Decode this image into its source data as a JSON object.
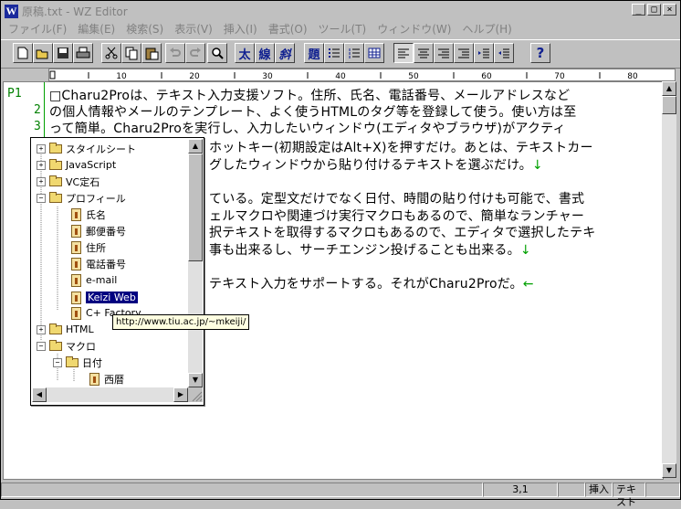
{
  "window": {
    "title": "原稿.txt - WZ Editor",
    "app_icon": "W"
  },
  "menu": [
    "ファイル(F)",
    "編集(E)",
    "検索(S)",
    "表示(V)",
    "挿入(I)",
    "書式(O)",
    "ツール(T)",
    "ウィンドウ(W)",
    "ヘルプ(H)"
  ],
  "toolbar": {
    "buttons": [
      "new-icon",
      "open-icon",
      "save-icon",
      "print-icon",
      "cut-icon",
      "copy-icon",
      "paste-icon",
      "undo-icon",
      "redo-icon",
      "find-icon"
    ],
    "bold": "太",
    "underline": "線",
    "italic": "斜",
    "heading": "題",
    "help": "?"
  },
  "ruler": {
    "labels": [
      "10",
      "20",
      "30",
      "40",
      "50",
      "60",
      "70",
      "80"
    ]
  },
  "editor": {
    "line_numbers": [
      "P1",
      "2",
      "3"
    ],
    "lines": [
      "□Charu2Proは、テキスト入力支援ソフト。住所、氏名、電話番号、メールアドレスなど",
      "の個人情報やメールのテンプレート、よく使うHTMLのタグ等を登録して使う。使い方は至",
      "って簡単。Charu2Proを実行し、入力したいウィンドウ(エディタやブラウザ)がアクティ",
      "ホットキー(初期設定はAlt+X)を押すだけ。あとは、テキストカー",
      "グしたウィンドウから貼り付けるテキストを選ぶだけ。",
      "",
      "ている。定型文だけでなく日付、時間の貼り付けも可能で、書式",
      "ェルマクロや関連づけ実行マクロもあるので、簡単なランチャー",
      "択テキストを取得するマクロもあるので、エディタで選択したテキ",
      "事も出来るし、サーチエンジン投げることも出来る。",
      "",
      "テキスト入力をサポートする。それがCharu2Proだ。"
    ],
    "eol_arrow": "↓",
    "eof_mark": "←"
  },
  "tree": {
    "items": [
      {
        "label": "スタイルシート",
        "type": "folder",
        "expander": "+"
      },
      {
        "label": "JavaScript",
        "type": "folder",
        "expander": "+"
      },
      {
        "label": "VC定石",
        "type": "folder",
        "expander": "+"
      },
      {
        "label": "プロフィール",
        "type": "folder",
        "expander": "−"
      },
      {
        "label": "氏名",
        "type": "item"
      },
      {
        "label": "郵便番号",
        "type": "item"
      },
      {
        "label": "住所",
        "type": "item"
      },
      {
        "label": "電話番号",
        "type": "item"
      },
      {
        "label": "e-mail",
        "type": "item"
      },
      {
        "label": "Keizi Web",
        "type": "item",
        "selected": true
      },
      {
        "label": "C+ Factory",
        "type": "item"
      },
      {
        "label": "HTML",
        "type": "folder",
        "expander": "+"
      },
      {
        "label": "マクロ",
        "type": "folder",
        "expander": "−"
      },
      {
        "label": "日付",
        "type": "folder",
        "expander": "−"
      },
      {
        "label": "西暦",
        "type": "item"
      }
    ],
    "tooltip": "http://www.tiu.ac.jp/~mkeiji/"
  },
  "status": {
    "position": "3,1",
    "insert_mode": "挿入",
    "file_type": "テキスト"
  }
}
